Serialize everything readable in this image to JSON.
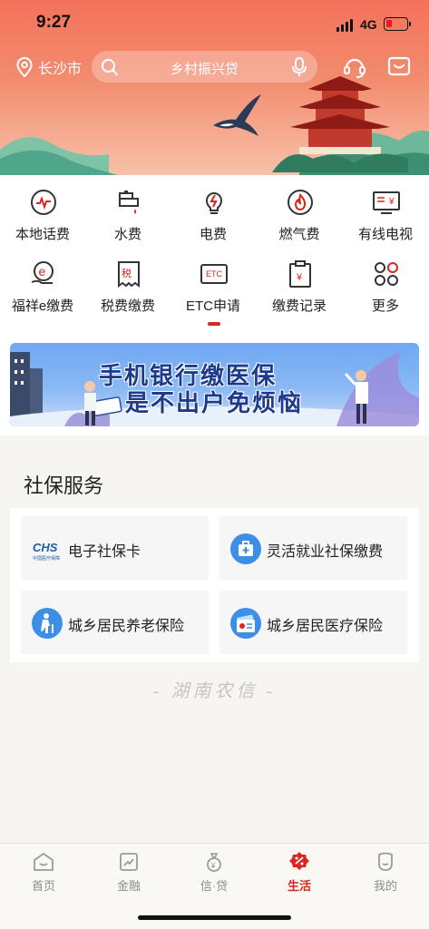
{
  "status_bar": {
    "time": "9:27",
    "network": "4G",
    "battery_level": 0.3
  },
  "header": {
    "city": "长沙市",
    "search_placeholder": "乡村振兴贷"
  },
  "services": [
    {
      "label": "本地话费",
      "icon": "phone-bill-icon"
    },
    {
      "label": "水费",
      "icon": "water-tap-icon"
    },
    {
      "label": "电费",
      "icon": "electricity-icon"
    },
    {
      "label": "燃气费",
      "icon": "gas-flame-icon"
    },
    {
      "label": "有线电视",
      "icon": "tv-icon"
    },
    {
      "label": "福祥e缴费",
      "icon": "e-pay-hand-icon"
    },
    {
      "label": "税费缴费",
      "icon": "tax-receipt-icon"
    },
    {
      "label": "ETC申请",
      "icon": "etc-card-icon"
    },
    {
      "label": "缴费记录",
      "icon": "payment-record-icon"
    },
    {
      "label": "更多",
      "icon": "more-grid-icon"
    }
  ],
  "promo": {
    "line1": "手机银行缴医保",
    "line2": "是不出户免烦恼"
  },
  "social": {
    "title": "社保服务",
    "items": [
      {
        "label": "电子社保卡",
        "icon": "chs-logo-icon"
      },
      {
        "label": "灵活就业社保缴费",
        "icon": "medical-kit-icon"
      },
      {
        "label": "城乡居民养老保险",
        "icon": "elderly-person-icon"
      },
      {
        "label": "城乡居民医疗保险",
        "icon": "medical-card-icon"
      }
    ],
    "chs_logo_text": "CHS",
    "chs_logo_sub": "中国医疗保障"
  },
  "footer_brand": "- 湖南农信 -",
  "tabs": [
    {
      "label": "首页",
      "icon": "home-icon",
      "active": false
    },
    {
      "label": "金融",
      "icon": "finance-chart-icon",
      "active": false
    },
    {
      "label": "信·贷",
      "icon": "money-bag-icon",
      "active": false
    },
    {
      "label": "生活",
      "icon": "life-badge-icon",
      "active": true
    },
    {
      "label": "我的",
      "icon": "profile-icon",
      "active": false
    }
  ],
  "colors": {
    "brand_red": "#d8271f",
    "hero_top": "#f4725b",
    "promo_text": "#1e3a8a"
  }
}
